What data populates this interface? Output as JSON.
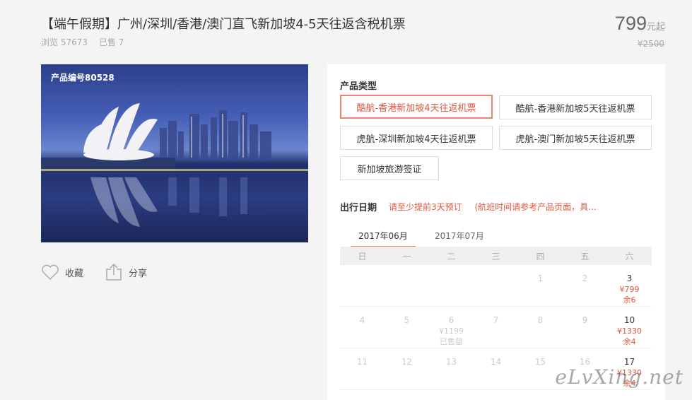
{
  "product": {
    "title": "【端午假期】广州/深圳/香港/澳门直飞新加坡4-5天往返含税机票",
    "views": "浏览 57673",
    "sold": "已售 7",
    "price": "799",
    "price_unit": "元起",
    "original_price": "¥2500",
    "code": "产品编号80528"
  },
  "actions": {
    "favorite": "收藏",
    "share": "分享"
  },
  "type_section": {
    "label": "产品类型",
    "options": [
      "酷航-香港新加坡4天往返机票",
      "酷航-香港新加坡5天往返机票",
      "虎航-深圳新加坡4天往返机票",
      "虎航-澳门新加坡5天往返机票",
      "新加坡旅游签证"
    ]
  },
  "date_section": {
    "label": "出行日期",
    "notice1": "请至少提前3天预订",
    "notice2": "(航班时间请参考产品页面，具..."
  },
  "calendar": {
    "months": [
      "2017年06月",
      "2017年07月"
    ],
    "weekdays": [
      "日",
      "一",
      "二",
      "三",
      "四",
      "五",
      "六"
    ],
    "rows": [
      [
        {
          "d": ""
        },
        {
          "d": ""
        },
        {
          "d": ""
        },
        {
          "d": ""
        },
        {
          "d": "1"
        },
        {
          "d": "2"
        },
        {
          "d": "3",
          "price": "¥799",
          "left": "余6"
        }
      ],
      [
        {
          "d": "4"
        },
        {
          "d": "5"
        },
        {
          "d": "6",
          "price_grey": "¥1199",
          "status": "已售罄"
        },
        {
          "d": "7"
        },
        {
          "d": "8"
        },
        {
          "d": "9"
        },
        {
          "d": "10",
          "price": "¥1330",
          "left": "余4"
        }
      ],
      [
        {
          "d": "11"
        },
        {
          "d": "12"
        },
        {
          "d": "13"
        },
        {
          "d": "14"
        },
        {
          "d": "15"
        },
        {
          "d": "16"
        },
        {
          "d": "17",
          "price": "¥1330",
          "left": "余4"
        }
      ]
    ]
  },
  "watermark": "eLvXing.net",
  "colors": {
    "accent": "#e2563d",
    "accent_border": "#e9846f",
    "background": "#f4f4f4"
  }
}
